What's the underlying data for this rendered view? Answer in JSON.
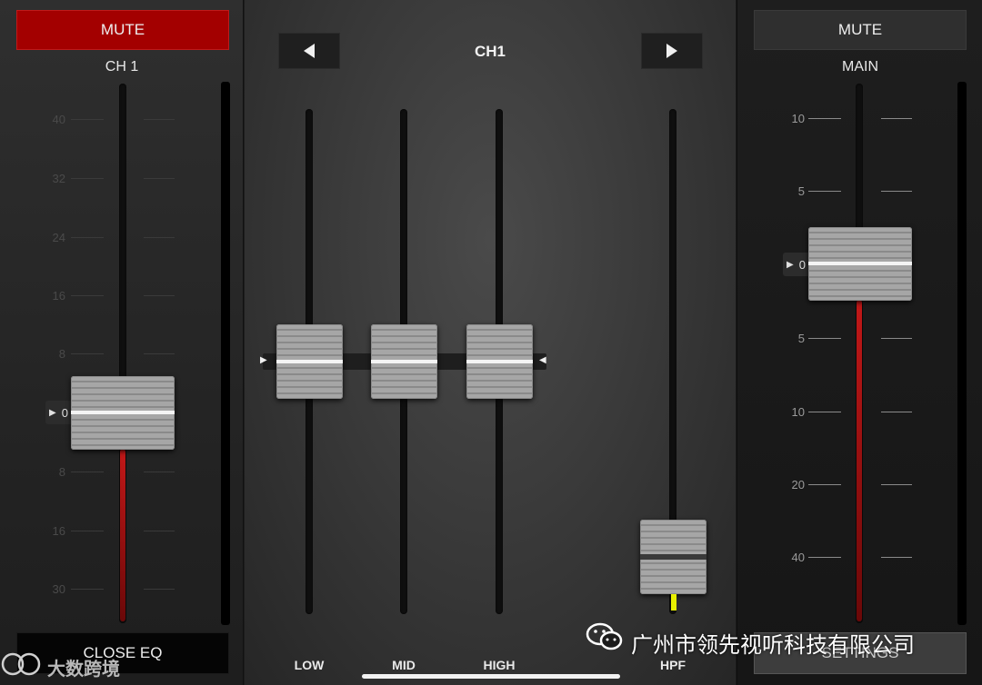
{
  "channel_strip": {
    "mute_label": "MUTE",
    "channel_label": "CH 1",
    "scale": [
      "40",
      "32",
      "24",
      "16",
      "8",
      "0",
      "8",
      "16",
      "30"
    ],
    "zero_marker": "0",
    "close_eq_label": "CLOSE EQ",
    "mute_color": "#a30000",
    "level_color": "#c21818"
  },
  "eq_panel": {
    "title": "CH1",
    "prev_icon": "triangle-left-icon",
    "next_icon": "triangle-right-icon",
    "bands": [
      {
        "label": "LOW"
      },
      {
        "label": "MID"
      },
      {
        "label": "HIGH"
      },
      {
        "label": "HPF"
      }
    ],
    "hpf_indicator_color": "#e8f000"
  },
  "main_strip": {
    "mute_label": "MUTE",
    "main_label": "MAIN",
    "scale": [
      "10",
      "5",
      "0",
      "5",
      "10",
      "20",
      "40"
    ],
    "settings_label": "SETTINGS"
  },
  "overlay": {
    "watermark_text": "广州市领先视听科技有限公司",
    "brand_text": "大数跨境"
  }
}
